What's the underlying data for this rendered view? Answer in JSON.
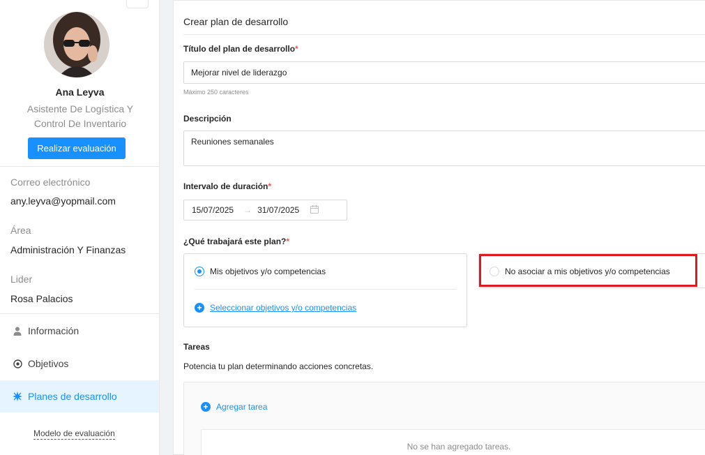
{
  "profile": {
    "name": "Ana Leyva",
    "role": "Asistente De Logística Y Control De Inventario",
    "evaluate_button": "Realizar evaluación"
  },
  "info": {
    "email_label": "Correo electrónico",
    "email_value": "any.leyva@yopmail.com",
    "area_label": "Área",
    "area_value": "Administración Y Finanzas",
    "leader_label": "Lider",
    "leader_value": "Rosa Palacios"
  },
  "nav": {
    "items": [
      {
        "label": "Información",
        "icon": "user-icon",
        "active": false
      },
      {
        "label": "Objetivos",
        "icon": "target-icon",
        "active": false
      },
      {
        "label": "Planes de desarrollo",
        "icon": "sparkle-icon",
        "active": true
      }
    ],
    "model_link": "Modelo de evaluación"
  },
  "form": {
    "title": "Crear plan de desarrollo",
    "plan_title_label": "Título del plan de desarrollo",
    "required_mark": "*",
    "plan_title_value": "Mejorar nivel de liderazgo",
    "plan_title_hint": "Máximo 250 caracteres",
    "description_label": "Descripción",
    "description_value": "Reuniones semanales",
    "duration_label": "Intervalo de duración",
    "start_date": "15/07/2025",
    "end_date": "31/07/2025",
    "work_label": "¿Qué trabajará este plan?",
    "option_objectives": "Mis objetivos y/o competencias",
    "option_no_associate": "No asociar a mis objetivos y/o competencias",
    "select_link": "Seleccionar objetivos y/o competencias",
    "selected_option": "option_objectives"
  },
  "tasks": {
    "label": "Tareas",
    "description": "Potencia tu plan determinando acciones concretas.",
    "add_button": "Agregar tarea",
    "empty_text": "No se han agregado tareas."
  },
  "colors": {
    "accent": "#1890ff",
    "highlight": "#e0191e",
    "active_bg": "#e6f4ff"
  }
}
